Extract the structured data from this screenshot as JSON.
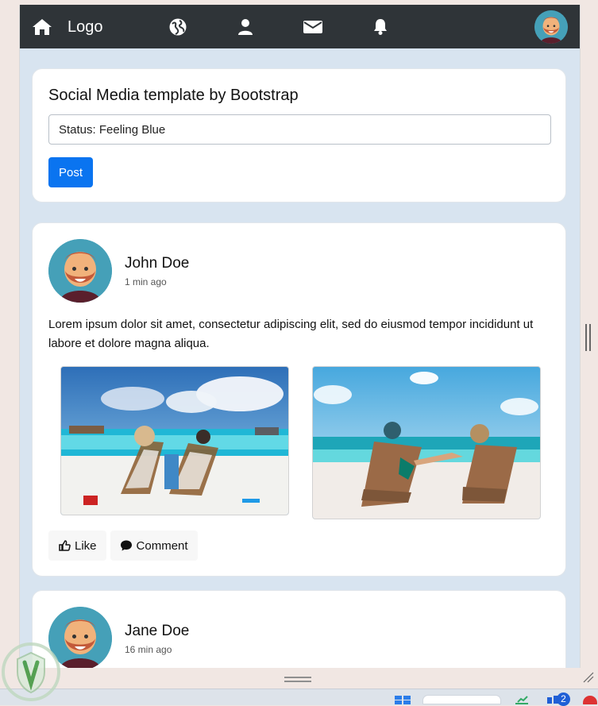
{
  "nav": {
    "logo": "Logo",
    "icons": {
      "home": "home-icon",
      "globe": "globe-icon",
      "user": "user-icon",
      "mail": "mail-icon",
      "bell": "bell-icon"
    }
  },
  "status_card": {
    "title": "Social Media template by Bootstrap",
    "input_value": "Status: Feeling Blue",
    "post_label": "Post"
  },
  "posts": [
    {
      "author": "John Doe",
      "time": "1 min ago",
      "text": "Lorem ipsum dolor sit amet, consectetur adipiscing elit, sed do eiusmod tempor incididunt ut labore et dolore magna aliqua.",
      "actions": {
        "like": "Like",
        "comment": "Comment"
      }
    },
    {
      "author": "Jane Doe",
      "time": "16 min ago"
    }
  ],
  "taskbar": {
    "badge": "2"
  },
  "colors": {
    "accent": "#0a74f0",
    "navbar": "#2f3438",
    "page_bg": "#d8e4f0"
  }
}
